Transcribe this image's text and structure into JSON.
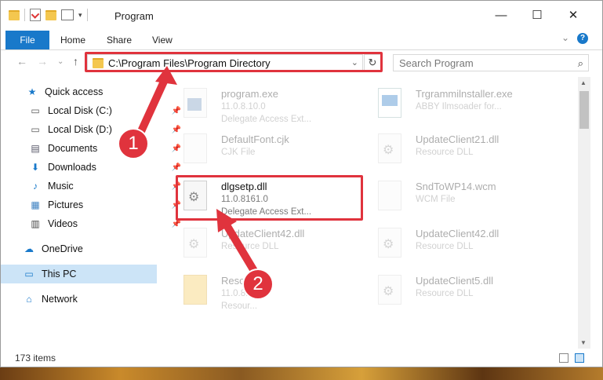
{
  "window": {
    "title": "Program",
    "minimize_label": "—",
    "maximize_label": "☐",
    "close_label": "✕"
  },
  "ribbon": {
    "file_tab": "File",
    "tabs": [
      "Home",
      "Share",
      "View"
    ],
    "help_label": "?",
    "collapse_label": "⌄"
  },
  "nav": {
    "back": "←",
    "forward": "→",
    "recent": "⌄",
    "up": "↑",
    "address": "C:\\Program Files\\Program Directory",
    "address_dropdown": "⌄",
    "refresh": "↻",
    "search_placeholder": "Search Program",
    "search_icon": "⌕"
  },
  "sidebar": {
    "items": [
      {
        "label": "Quick access",
        "icon": "★"
      },
      {
        "label": "Local Disk (C:)",
        "icon": "▭"
      },
      {
        "label": "Local Disk (D:)",
        "icon": "▭"
      },
      {
        "label": "Documents",
        "icon": "▤"
      },
      {
        "label": "Downloads",
        "icon": "⬇"
      },
      {
        "label": "Music",
        "icon": "♪"
      },
      {
        "label": "Pictures",
        "icon": "▦"
      },
      {
        "label": "Videos",
        "icon": "▥"
      },
      {
        "label": "OneDrive",
        "icon": "☁"
      },
      {
        "label": "This PC",
        "icon": "▭"
      },
      {
        "label": "Network",
        "icon": "⌂"
      }
    ]
  },
  "files": {
    "program_exe": {
      "name": "program.exe",
      "line2": "11.0.8.10.0",
      "line3": "Delegate Access Ext..."
    },
    "installer": {
      "name": "Trgrammilnstaller.exe",
      "line2": "ABBY Ilmsoader for..."
    },
    "defaultfont": {
      "name": "DefaultFont.cjk",
      "line2": "CJK File"
    },
    "updateclient21": {
      "name": "UpdateClient21.dll",
      "line2": "Resource DLL"
    },
    "dlgsetp": {
      "name": "dlgsetp.dll",
      "line2": "11.0.8161.0",
      "line3": "Delegate Access Ext..."
    },
    "sndtowcm": {
      "name": "SndToWP14.wcm",
      "line2": "WCM File"
    },
    "updateclient42a": {
      "name": "UpdateClient42.dll",
      "line2": "Resource DLL"
    },
    "updateclient42b": {
      "name": "UpdateClient42.dll",
      "line2": "Resource DLL"
    },
    "resource": {
      "name": "Resou...",
      "line2": "11.0.8...",
      "line3": "Resour..."
    },
    "updateclient5": {
      "name": "UpdateClient5.dll",
      "line2": "Resource DLL"
    }
  },
  "status": {
    "items_count": "173 items"
  },
  "callouts": {
    "step1": "1",
    "step2": "2"
  },
  "colors": {
    "accent": "#1979ca",
    "highlight": "#e0333d",
    "selected": "#cce4f7"
  }
}
